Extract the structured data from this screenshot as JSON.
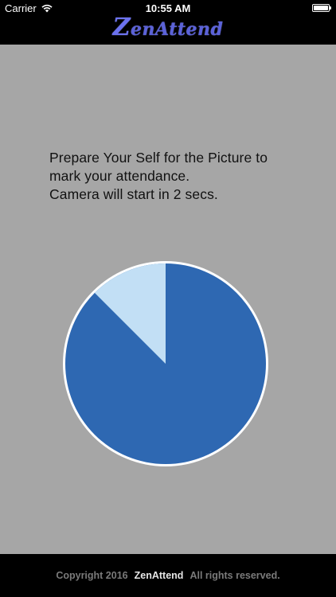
{
  "status_bar": {
    "carrier": "Carrier",
    "time": "10:55 AM",
    "wifi_icon": "wifi-icon",
    "battery_icon": "battery-icon"
  },
  "nav": {
    "logo_initial": "Z",
    "logo_rest": "enAttend",
    "logo_color": "#5b62d8"
  },
  "message": {
    "line1": "Prepare Your Self for the Picture to",
    "line2": "mark your attendance.",
    "line3": "Camera will start in 2 secs."
  },
  "timer": {
    "progress_fraction": 0.125,
    "elapsed_color": "#c2dff5",
    "remaining_color": "#2e68b2",
    "border_color": "#ffffff"
  },
  "footer": {
    "copyright": "Copyright 2016",
    "brand": "ZenAttend",
    "rights": "All rights reserved."
  }
}
